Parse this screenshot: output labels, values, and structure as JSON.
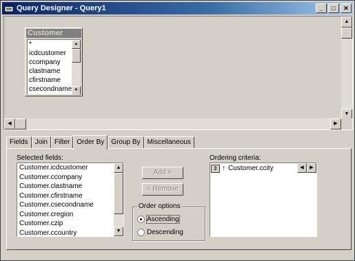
{
  "window": {
    "title": "Query Designer - Query1",
    "controls": {
      "minimize": "_",
      "maximize": "□",
      "close": "✕"
    }
  },
  "table": {
    "caption": "Customer",
    "fields": [
      "*",
      "icdcustomer",
      "ccompany",
      "clastname",
      "cfirstname",
      "csecondname"
    ]
  },
  "tabs": [
    "Fields",
    "Join",
    "Filter",
    "Order By",
    "Group By",
    "Miscellaneous"
  ],
  "active_tab": "Order By",
  "order_by": {
    "selected_fields_label": "Selected fields:",
    "selected_fields": [
      "Customer.icdcustomer",
      "Customer.ccompany",
      "Customer.clastname",
      "Customer.cfirstname",
      "Customer.csecondname",
      "Customer.cregion",
      "Customer.czip",
      "Customer.ccountry"
    ],
    "add_button": "Add >",
    "remove_button": "< Remove",
    "order_options_label": "Order options",
    "ascending_label": "Ascending",
    "descending_label": "Descending",
    "selected_order": "ascending",
    "ordering_criteria_label": "Ordering criteria:",
    "ordering_criteria": [
      {
        "direction_icon": "up-arrow",
        "field": "Customer.ccity"
      }
    ]
  },
  "icons": {
    "scroll_up": "▲",
    "scroll_down": "▼",
    "scroll_left": "◀",
    "scroll_right": "▶",
    "sort_up": "↑",
    "move_handle": "⇕"
  }
}
